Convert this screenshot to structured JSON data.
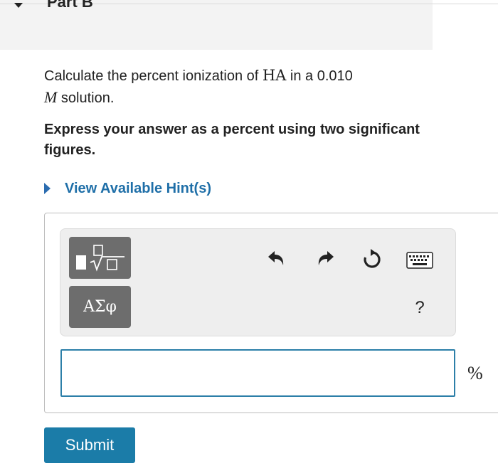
{
  "part": {
    "title": "Part B"
  },
  "question": {
    "prefix": "Calculate the percent ionization of ",
    "species": "HA",
    "middle": " in a 0.010",
    "unit": "M",
    "suffix": " solution."
  },
  "instruction": "Express your answer as a percent using two significant figures.",
  "hint": {
    "label": "View Available Hint(s)"
  },
  "toolbar": {
    "templates_icon": "templates-sqrt-icon",
    "greek_label": "ΑΣφ",
    "undo_icon": "undo-icon",
    "redo_icon": "redo-icon",
    "reset_icon": "reset-icon",
    "keyboard_icon": "keyboard-icon",
    "help_label": "?"
  },
  "answer": {
    "value": "",
    "units": "%"
  },
  "submit": {
    "label": "Submit"
  },
  "colors": {
    "accent": "#1b7ca8",
    "hint_link": "#1f6fa8",
    "tool_button": "#6d6d6d",
    "input_border": "#2c7fa8"
  }
}
